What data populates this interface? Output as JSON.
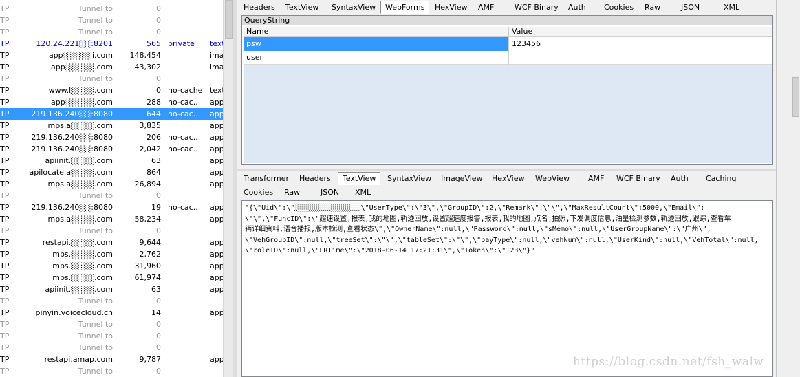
{
  "sessions": [
    {
      "proto": "TP",
      "host": "Tunnel to",
      "body": "0",
      "caching": "",
      "ctype": "",
      "kind": "tunnel"
    },
    {
      "proto": "TP",
      "host": "Tunnel to",
      "body": "0",
      "caching": "",
      "ctype": "",
      "kind": "tunnel"
    },
    {
      "proto": "TP",
      "host": "Tunnel to",
      "body": "0",
      "caching": "",
      "ctype": "",
      "kind": "tunnel"
    },
    {
      "proto": "TP",
      "host": "120.24.221░░:8201",
      "body": "565",
      "caching": "private",
      "ctype": "text",
      "kind": "blue"
    },
    {
      "proto": "TP",
      "host": "app░░░░░i.com",
      "body": "148,454",
      "caching": "",
      "ctype": "imag",
      "kind": "normal"
    },
    {
      "proto": "TP",
      "host": "app░░░░░.com",
      "body": "43,302",
      "caching": "",
      "ctype": "imag",
      "kind": "normal"
    },
    {
      "proto": "TP",
      "host": "Tunnel to",
      "body": "0",
      "caching": "",
      "ctype": "",
      "kind": "tunnel"
    },
    {
      "proto": "TP",
      "host": "www.l░░░░.com",
      "body": "0",
      "caching": "no-cache",
      "ctype": "text",
      "kind": "normal"
    },
    {
      "proto": "TP",
      "host": "app░░░░░.com",
      "body": "288",
      "caching": "no-cac...",
      "ctype": "app",
      "kind": "normal"
    },
    {
      "proto": "TP",
      "host": "219.136.240░░:8080",
      "body": "644",
      "caching": "no-cac...",
      "ctype": "app",
      "kind": "selected"
    },
    {
      "proto": "TP",
      "host": "mps.a░░░░.com",
      "body": "3,835",
      "caching": "",
      "ctype": "app",
      "kind": "normal"
    },
    {
      "proto": "TP",
      "host": "219.136.240░░:8080",
      "body": "206",
      "caching": "no-cac...",
      "ctype": "app",
      "kind": "normal"
    },
    {
      "proto": "TP",
      "host": "219.136.240░░:8080",
      "body": "2,042",
      "caching": "no-cac...",
      "ctype": "app",
      "kind": "normal"
    },
    {
      "proto": "TP",
      "host": "apiinit.░░░░.com",
      "body": "63",
      "caching": "",
      "ctype": "app",
      "kind": "normal"
    },
    {
      "proto": "TP",
      "host": "apilocate.a░░░░.com",
      "body": "864",
      "caching": "",
      "ctype": "app",
      "kind": "normal"
    },
    {
      "proto": "TP",
      "host": "mps.a░░░░.com",
      "body": "26,894",
      "caching": "",
      "ctype": "app",
      "kind": "normal"
    },
    {
      "proto": "TP",
      "host": "Tunnel to",
      "body": "0",
      "caching": "",
      "ctype": "",
      "kind": "tunnel"
    },
    {
      "proto": "TP",
      "host": "219.136.240░░:8080",
      "body": "19",
      "caching": "no-cac...",
      "ctype": "app",
      "kind": "normal"
    },
    {
      "proto": "TP",
      "host": "mps.a░░░░.com",
      "body": "58,234",
      "caching": "",
      "ctype": "app",
      "kind": "normal"
    },
    {
      "proto": "TP",
      "host": "Tunnel to",
      "body": "0",
      "caching": "",
      "ctype": "",
      "kind": "tunnel"
    },
    {
      "proto": "TP",
      "host": "restapi.░░░░.com",
      "body": "9,644",
      "caching": "",
      "ctype": "app",
      "kind": "normal"
    },
    {
      "proto": "TP",
      "host": "mps.░░░░.com",
      "body": "2,762",
      "caching": "",
      "ctype": "app",
      "kind": "normal"
    },
    {
      "proto": "TP",
      "host": "mps.░░░░.com",
      "body": "31,960",
      "caching": "",
      "ctype": "app",
      "kind": "normal"
    },
    {
      "proto": "TP",
      "host": "mps.░░░░.com",
      "body": "61,974",
      "caching": "",
      "ctype": "app",
      "kind": "normal"
    },
    {
      "proto": "TP",
      "host": "apiinit.░░░░.com",
      "body": "63",
      "caching": "",
      "ctype": "app",
      "kind": "normal"
    },
    {
      "proto": "TP",
      "host": "Tunnel to",
      "body": "0",
      "caching": "",
      "ctype": "",
      "kind": "tunnel"
    },
    {
      "proto": "TP",
      "host": "pinyin.voicecloud.cn",
      "body": "14",
      "caching": "",
      "ctype": "app",
      "kind": "normal"
    },
    {
      "proto": "TP",
      "host": "Tunnel to",
      "body": "0",
      "caching": "",
      "ctype": "",
      "kind": "tunnel"
    },
    {
      "proto": "TP",
      "host": "Tunnel to",
      "body": "0",
      "caching": "",
      "ctype": "",
      "kind": "tunnel"
    },
    {
      "proto": "TP",
      "host": "Tunnel to",
      "body": "0",
      "caching": "",
      "ctype": "",
      "kind": "tunnel"
    },
    {
      "proto": "TP",
      "host": "restapi.amap.com",
      "body": "9,787",
      "caching": "",
      "ctype": "app",
      "kind": "normal"
    },
    {
      "proto": "TP",
      "host": "Tunnel to",
      "body": "0",
      "caching": "",
      "ctype": "",
      "kind": "tunnel"
    }
  ],
  "request_tabs": [
    {
      "label": "Headers",
      "active": false
    },
    {
      "label": "TextView",
      "active": false
    },
    {
      "label": "SyntaxView",
      "active": false
    },
    {
      "label": "WebForms",
      "active": true
    },
    {
      "label": "HexView",
      "active": false
    },
    {
      "label": "AMF",
      "active": false
    },
    {
      "label": "WCF Binary",
      "active": false
    },
    {
      "label": "Auth",
      "active": false
    },
    {
      "label": "Cookies",
      "active": false
    },
    {
      "label": "Raw",
      "active": false
    },
    {
      "label": "JSON",
      "active": false
    },
    {
      "label": "XML",
      "active": false
    }
  ],
  "webforms": {
    "section_title": "QueryString",
    "col_name": "Name",
    "col_value": "Value",
    "rows": [
      {
        "name": "psw",
        "value": "123456",
        "selected": true
      },
      {
        "name": "user",
        "value": "",
        "selected": false
      }
    ]
  },
  "response_tabs_row1": [
    {
      "label": "Transformer",
      "active": false
    },
    {
      "label": "Headers",
      "active": false
    },
    {
      "label": "TextView",
      "active": true
    },
    {
      "label": "SyntaxView",
      "active": false
    },
    {
      "label": "ImageView",
      "active": false
    },
    {
      "label": "HexView",
      "active": false
    },
    {
      "label": "WebView",
      "active": false
    },
    {
      "label": "AMF",
      "active": false
    },
    {
      "label": "WCF Binary",
      "active": false
    },
    {
      "label": "Auth",
      "active": false
    },
    {
      "label": "Caching",
      "active": false
    }
  ],
  "response_tabs_row2": [
    {
      "label": "Cookies",
      "active": false
    },
    {
      "label": "Raw",
      "active": false
    },
    {
      "label": "JSON",
      "active": false
    },
    {
      "label": "XML",
      "active": false
    }
  ],
  "response_text": [
    "\"{\\\"Uid\\\":\\\"░░░░░░░░░░░░░░░░\\\"UserType\\\":\\\"3\\\",\\\"GroupID\\\":2,\\\"Remark\\\":\\\"\\\",\\\"MaxResultCount\\\":5000,\\\"Email\\\":",
    "\\\"\\\",\\\"FuncID\\\":\\\"超速设置,报表,我的地图,轨迹回放,设置超速度报警,报表,我的地图,点名,拍照,下发调度信息,油量检测参数,轨迹回放,跟踪,查看车",
    "辆详细资料,语音播报,版本检测,查看状态\\\",\\\"OwnerName\\\":null,\\\"Password\\\":null,\\\"sMemo\\\":null,\\\"UserGroupName\\\":\\\"广州\\\",",
    "\\\"VehGroupID\\\":null,\\\"treeSet\\\":\\\"\\\",\\\"tableSet\\\":\\\"\\\",\\\"payType\\\":null,\\\"vehNum\\\":null,\\\"UserKind\\\":null,\\\"VehTotal\\\":null,",
    "\\\"roleID\\\":null,\\\"LRTime\\\":\\\"2018-06-14 17:21:31\\\",\\\"Token\\\":\\\"123\\\"}\""
  ],
  "watermark": "https://blog.csdn.net/fsh_walw",
  "colors": {
    "selection": "#3399ff",
    "tunnel_text": "#9a9a9a",
    "blue_text": "#0000c8",
    "grid_empty": "#dde8f4"
  }
}
